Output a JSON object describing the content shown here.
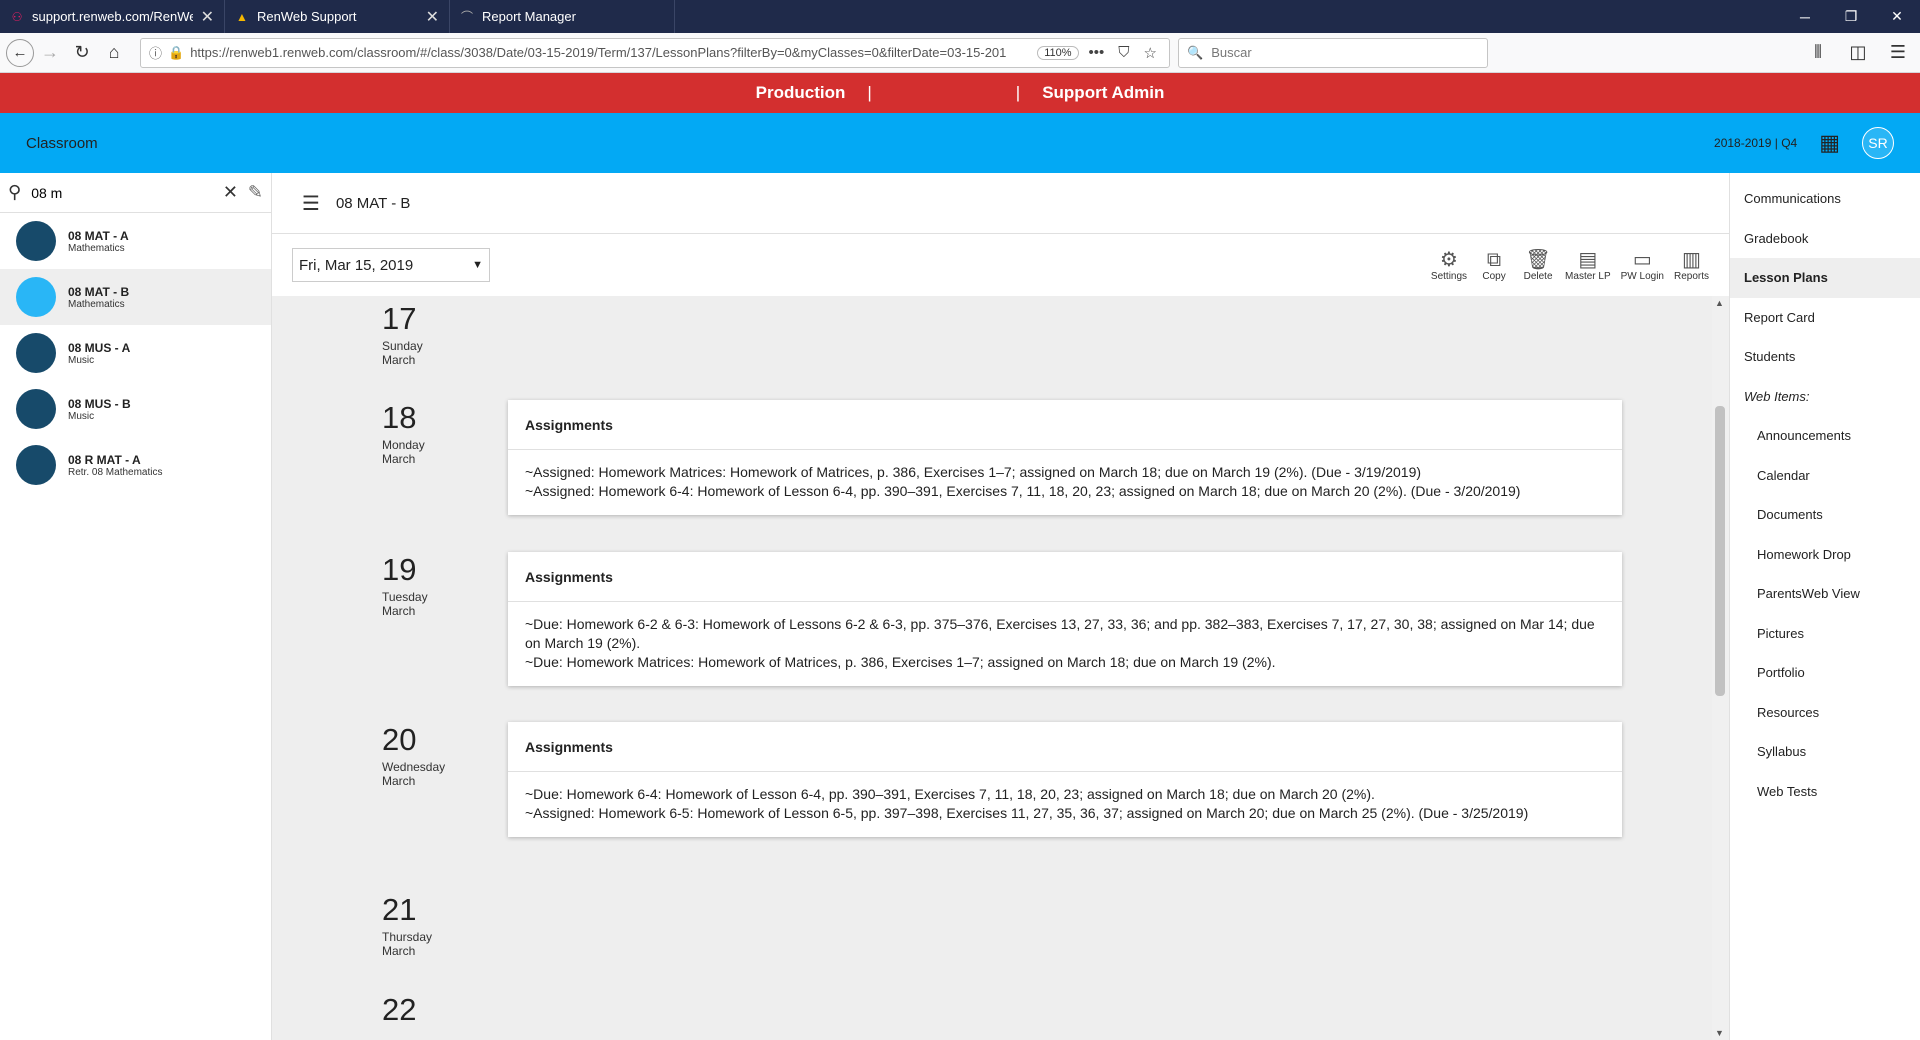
{
  "browser": {
    "tabs": [
      {
        "title": "support.renweb.com/RenWeb/",
        "icon": "link-icon"
      },
      {
        "title": "RenWeb Support",
        "icon": "renweb-icon"
      },
      {
        "title": "Report Manager",
        "icon": "report-icon"
      }
    ],
    "url": "https://renweb1.renweb.com/classroom/#/class/3038/Date/03-15-2019/Term/137/LessonPlans?filterBy=0&myClasses=0&filterDate=03-15-201",
    "zoom": "110%",
    "search_placeholder": "Buscar"
  },
  "banner": {
    "left": "Production",
    "sep1": "|",
    "sep2": "|",
    "right": "Support Admin"
  },
  "appbar": {
    "title": "Classroom",
    "term": "2018-2019 | Q4",
    "avatar": "SR"
  },
  "sidebar": {
    "search_value": "08 m",
    "classes": [
      {
        "name": "08 MAT - A",
        "subject": "Mathematics"
      },
      {
        "name": "08 MAT - B",
        "subject": "Mathematics"
      },
      {
        "name": "08 MUS - A",
        "subject": "Music"
      },
      {
        "name": "08 MUS - B",
        "subject": "Music"
      },
      {
        "name": "08 R MAT - A",
        "subject": "Retr. 08 Mathematics"
      }
    ]
  },
  "main": {
    "title": "08 MAT - B",
    "date": "Fri, Mar 15, 2019",
    "tools": [
      "Settings",
      "Copy",
      "Delete",
      "Master LP",
      "PW Login",
      "Reports"
    ],
    "days": [
      {
        "num": "17",
        "name": "Sunday",
        "month": "March"
      },
      {
        "num": "18",
        "name": "Monday",
        "month": "March"
      },
      {
        "num": "19",
        "name": "Tuesday",
        "month": "March"
      },
      {
        "num": "20",
        "name": "Wednesday",
        "month": "March"
      },
      {
        "num": "21",
        "name": "Thursday",
        "month": "March"
      },
      {
        "num": "22",
        "name": "",
        "month": ""
      }
    ],
    "cards": [
      {
        "title": "Assignments",
        "lines": [
          "~Assigned: Homework Matrices: Homework of Matrices, p. 386, Exercises 1–7; assigned on March 18; due on March 19 (2%). (Due - 3/19/2019)",
          "~Assigned: Homework 6-4: Homework of Lesson 6-4, pp. 390–391, Exercises 7, 11, 18, 20, 23; assigned on March 18; due on March 20 (2%). (Due - 3/20/2019)"
        ]
      },
      {
        "title": "Assignments",
        "lines": [
          "~Due: Homework 6-2 & 6-3: Homework of Lessons 6-2 & 6-3, pp. 375–376, Exercises 13, 27, 33, 36; and pp. 382–383, Exercises 7, 17, 27, 30, 38; assigned on Mar 14; due on March 19 (2%).",
          "~Due: Homework Matrices: Homework of Matrices, p. 386, Exercises 1–7; assigned on March 18; due on March 19 (2%)."
        ]
      },
      {
        "title": "Assignments",
        "lines": [
          "~Due: Homework 6-4: Homework of Lesson 6-4, pp. 390–391, Exercises 7, 11, 18, 20, 23; assigned on March 18; due on March 20 (2%).",
          "~Assigned: Homework 6-5: Homework of Lesson 6-5, pp. 397–398, Exercises 11, 27, 35, 36, 37; assigned on March 20; due on March 25 (2%). (Due - 3/25/2019)"
        ]
      }
    ]
  },
  "rightmenu": {
    "items": [
      "Communications",
      "Gradebook",
      "Lesson Plans",
      "Report Card",
      "Students",
      "Web Items:"
    ],
    "sub_items": [
      "Announcements",
      "Calendar",
      "Documents",
      "Homework Drop",
      "ParentsWeb View",
      "Pictures",
      "Portfolio",
      "Resources",
      "Syllabus",
      "Web Tests"
    ]
  }
}
